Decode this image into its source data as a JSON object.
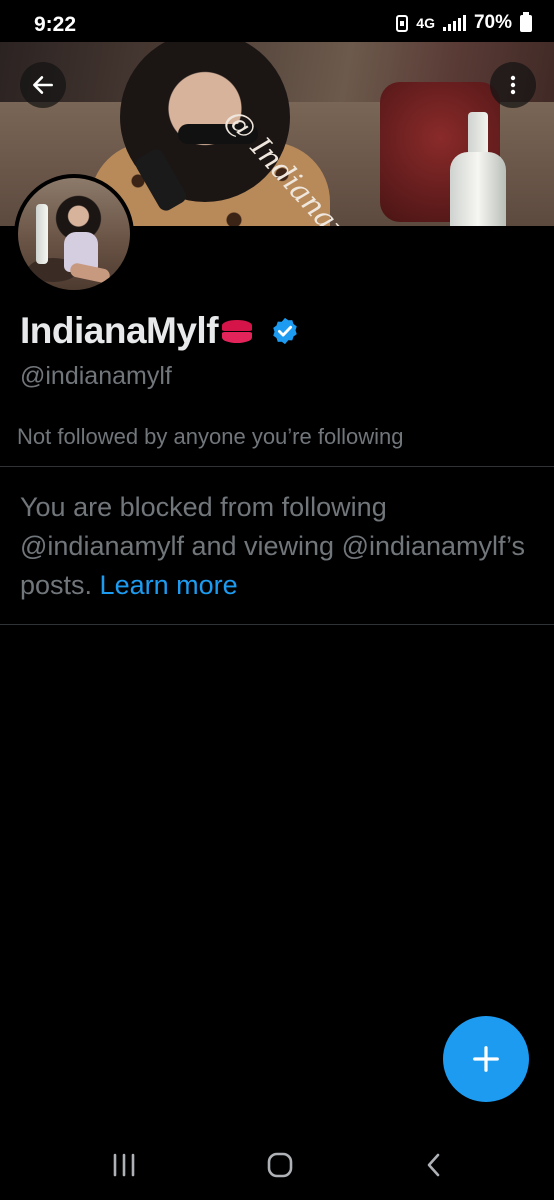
{
  "status_bar": {
    "time": "9:22",
    "network": "4G",
    "battery": "70%",
    "icons": [
      "battery-saver-icon",
      "signal-icon",
      "battery-icon"
    ]
  },
  "banner": {
    "watermark": "@ Indianamylf"
  },
  "header": {
    "back_icon": "arrow-left-icon",
    "more_icon": "more-vertical-icon"
  },
  "profile": {
    "display_name": "IndianaMylf",
    "name_emoji": "lips-icon",
    "verified": true,
    "handle": "@indianamylf",
    "followed_by": "Not followed by anyone you’re following"
  },
  "blocked_notice": {
    "text": "You are blocked from following @indianamylf and viewing @indianamylf’s posts. ",
    "link": "Learn more"
  },
  "colors": {
    "background": "#000000",
    "text_primary": "#e7e9ea",
    "text_secondary": "#71767b",
    "accent": "#1d9bf0",
    "divider": "#2f3336"
  },
  "fab": {
    "icon": "plus-icon"
  },
  "nav_bar": {
    "icons": [
      "recents-icon",
      "home-icon",
      "back-icon"
    ]
  }
}
